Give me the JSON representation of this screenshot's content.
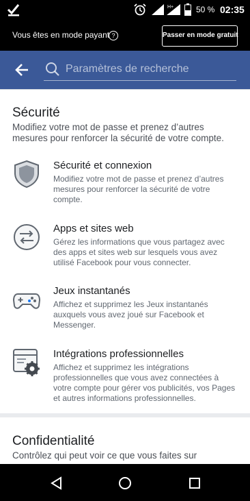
{
  "status_bar": {
    "battery_percent": "50 %",
    "time": "02:35",
    "network_label": "H+"
  },
  "data_mode": {
    "text": "Vous êtes en mode payant",
    "help_glyph": "?",
    "switch_button": "Passer en mode gratuit"
  },
  "search": {
    "placeholder": "Paramètres de recherche"
  },
  "security": {
    "title": "Sécurité",
    "description": "Modifiez votre mot de passe et prenez d’autres mesures pour renforcer la sécurité de votre compte.",
    "items": [
      {
        "title": "Sécurité et connexion",
        "description": "Modifiez votre mot de passe et prenez d’autres mesures pour renforcer la sécurité de votre compte."
      },
      {
        "title": "Apps et sites web",
        "description": "Gérez les informations que vous partagez avec des apps et sites web sur lesquels vous avez utilisé Facebook pour vous connecter."
      },
      {
        "title": "Jeux instantanés",
        "description": "Affichez et supprimez les Jeux instantanés auxquels vous avez joué sur Facebook et Messenger."
      },
      {
        "title": "Intégrations professionnelles",
        "description": "Affichez et supprimez les intégrations professionnelles que vous avez connectées à votre compte pour gérer vos publicités, vos Pages et autres informations professionnelles."
      }
    ]
  },
  "privacy": {
    "title": "Confidentialité",
    "description": "Contrôlez qui peut voir ce que vous faites sur"
  },
  "colors": {
    "header_blue": "#3b5998",
    "icon_gray": "#606770"
  },
  "icons": {
    "status": [
      "check-icon",
      "alarm-icon",
      "signal-icon",
      "battery-icon"
    ],
    "nav": [
      "back-triangle-icon",
      "home-circle-icon",
      "recents-square-icon"
    ]
  }
}
